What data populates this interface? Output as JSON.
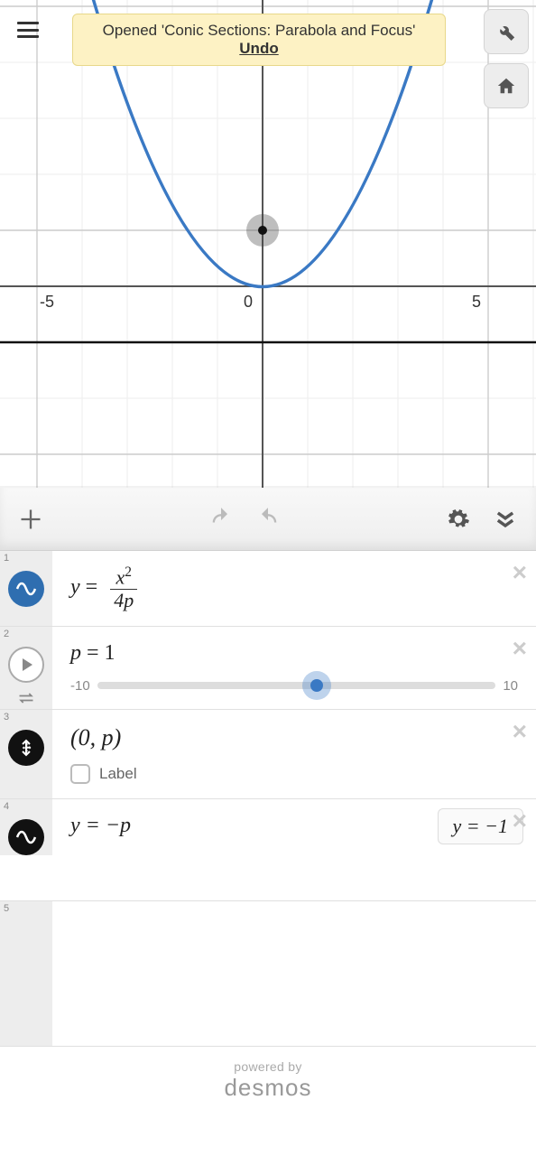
{
  "toast": {
    "message": "Opened 'Conic Sections: Parabola and Focus'",
    "action_label": "Undo"
  },
  "chart_data": {
    "type": "line",
    "title": "",
    "xlabel": "",
    "ylabel": "",
    "xlim": [
      -6,
      6
    ],
    "ylim": [
      -4,
      7
    ],
    "ticks_x": [
      -5,
      0,
      5
    ],
    "p": 1,
    "series": [
      {
        "name": "y = x²/(4p)",
        "kind": "parabola",
        "equation": "y = x^2 / 4"
      },
      {
        "name": "y = -p",
        "kind": "hline",
        "y": -1
      }
    ],
    "points": [
      {
        "name": "focus",
        "coords": [
          0,
          1
        ]
      }
    ]
  },
  "expressions": [
    {
      "index": "1",
      "kind": "formula",
      "lhs": "y",
      "frac_num": "x",
      "frac_num_exp": "2",
      "frac_den": "4p"
    },
    {
      "index": "2",
      "kind": "slider",
      "var": "p",
      "value": "1",
      "min": "-10",
      "max": "10",
      "pos_pct": 55
    },
    {
      "index": "3",
      "kind": "point",
      "text": "(0, p)",
      "label_checkbox": "Label"
    },
    {
      "index": "4",
      "kind": "line",
      "text": "y  =  −p",
      "result": "y  =  −1"
    },
    {
      "index": "5",
      "kind": "empty"
    }
  ],
  "footer": {
    "powered": "powered by",
    "brand": "desmos"
  }
}
